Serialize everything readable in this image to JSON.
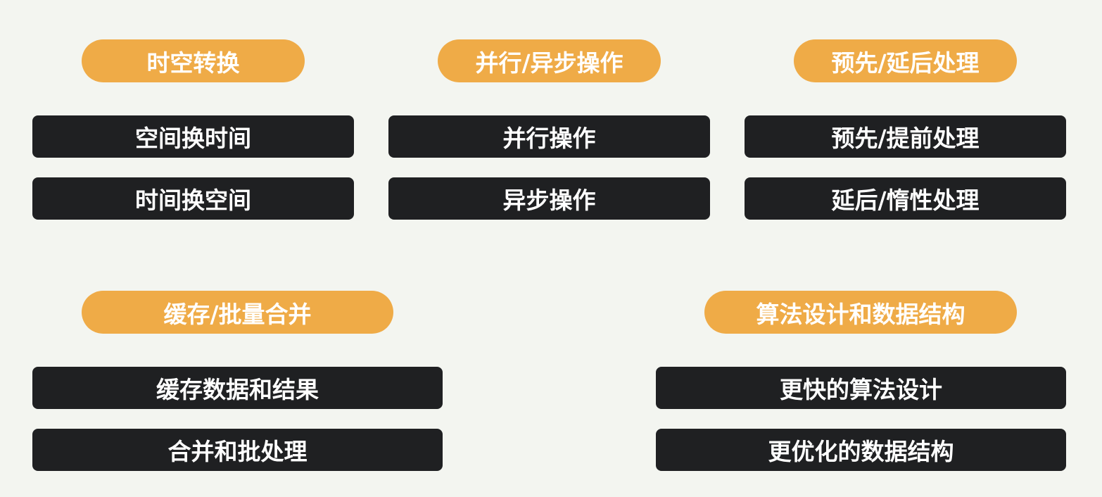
{
  "groups": [
    {
      "title": "时空转换",
      "items": [
        "空间换时间",
        "时间换空间"
      ]
    },
    {
      "title": "并行/异步操作",
      "items": [
        "并行操作",
        "异步操作"
      ]
    },
    {
      "title": "预先/延后处理",
      "items": [
        "预先/提前处理",
        "延后/惰性处理"
      ]
    },
    {
      "title": "缓存/批量合并",
      "items": [
        "缓存数据和结果",
        "合并和批处理"
      ]
    },
    {
      "title": "算法设计和数据结构",
      "items": [
        "更快的算法设计",
        "更优化的数据结构"
      ]
    }
  ],
  "colors": {
    "background": "#f3f5f0",
    "category_pill": "#efab47",
    "item_bar": "#1f2022",
    "text": "#ffffff"
  }
}
